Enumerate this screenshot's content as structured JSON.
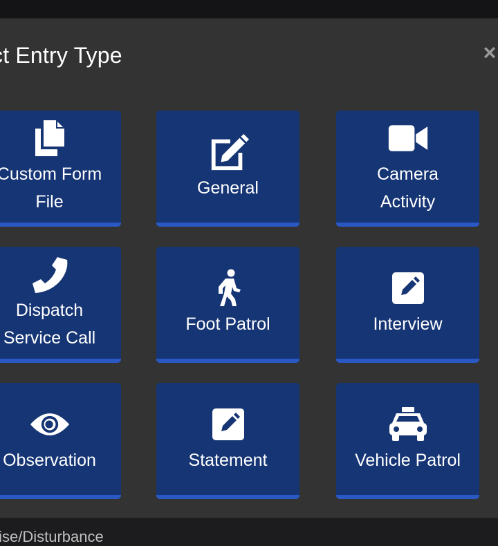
{
  "modal": {
    "title": "ect Entry Type",
    "close_label": "×"
  },
  "tiles": [
    {
      "label1": "Custom Form",
      "label2": "File",
      "icon": "copy-icon"
    },
    {
      "label1": "General",
      "icon": "edit-icon"
    },
    {
      "label1": "Camera",
      "label2": "Activity",
      "icon": "video-camera-icon"
    },
    {
      "label1": "Dispatch",
      "label2": "Service Call",
      "icon": "phone-icon"
    },
    {
      "label1": "Foot Patrol",
      "icon": "walking-person-icon"
    },
    {
      "label1": "Interview",
      "icon": "pencil-square-icon"
    },
    {
      "label1": "Observation",
      "icon": "eye-icon"
    },
    {
      "label1": "Statement",
      "icon": "pencil-square-icon"
    },
    {
      "label1": "Vehicle Patrol",
      "icon": "taxi-icon"
    }
  ],
  "background": {
    "list_item": "Noise/Disturbance"
  },
  "colors": {
    "tile_bg": "#163574",
    "tile_border": "#2a58c4",
    "modal_bg": "#333333"
  }
}
